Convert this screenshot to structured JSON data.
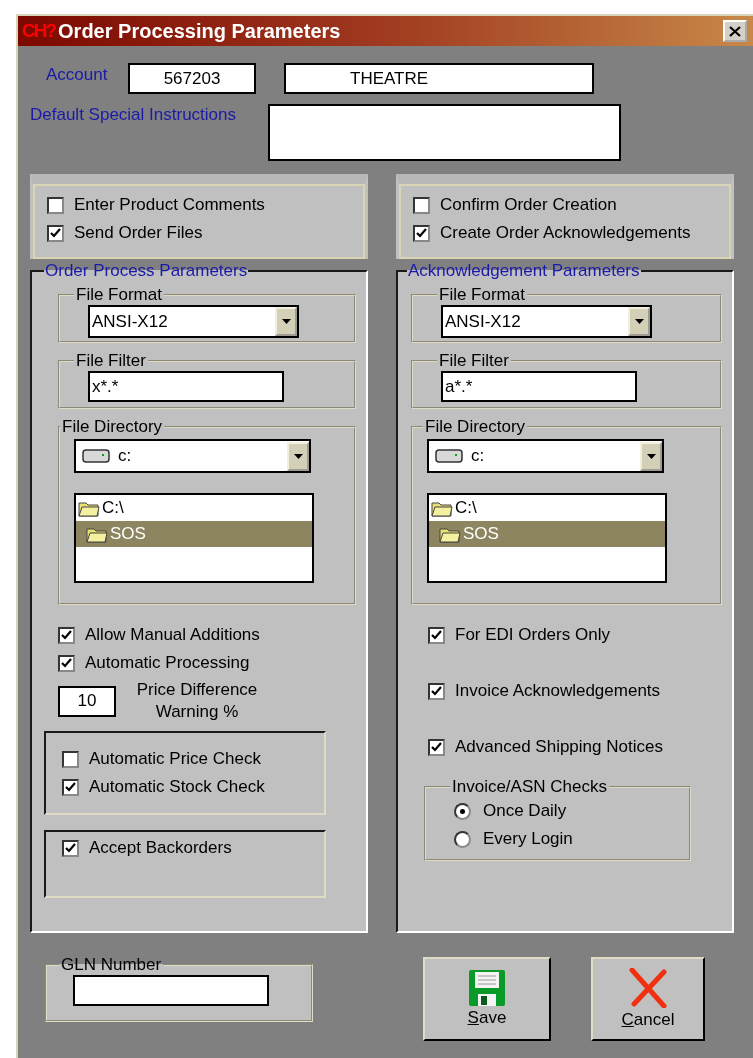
{
  "window": {
    "logo": "CH?",
    "title": "Order Processing Parameters"
  },
  "account": {
    "label": "Account",
    "number": "567203",
    "name": "THEATRE"
  },
  "special_instructions": {
    "label": "Default Special Instructions"
  },
  "columns": [
    {
      "options": [
        {
          "label": "Enter Product Comments",
          "checked": false
        },
        {
          "label": "Send Order Files",
          "checked": true
        }
      ],
      "group": {
        "title": "Order Process Parameters",
        "file_format": {
          "label": "File Format",
          "value": "ANSI-X12"
        },
        "file_filter": {
          "label": "File Filter",
          "value": "x*.*"
        },
        "file_directory": {
          "label": "File Directory",
          "drive": "c:",
          "folders": [
            {
              "name": "C:\\",
              "selected": false,
              "children": [
                {
                  "name": "SOS",
                  "selected": true
                }
              ]
            }
          ]
        },
        "items": [
          {
            "kind": "checkbox",
            "label": "Allow Manual Additions",
            "checked": true
          },
          {
            "kind": "checkbox",
            "label": "Automatic Processing",
            "checked": true
          },
          {
            "kind": "number",
            "value": "10",
            "label": "Price Difference Warning %"
          },
          {
            "kind": "checkgroup",
            "options": [
              {
                "label": "Automatic Price Check",
                "checked": false
              },
              {
                "label": "Automatic Stock Check",
                "checked": true
              }
            ]
          },
          {
            "kind": "checkgroup",
            "options": [
              {
                "label": "Accept Backorders",
                "checked": true
              }
            ]
          }
        ]
      }
    },
    {
      "options": [
        {
          "label": "Confirm Order Creation",
          "checked": false
        },
        {
          "label": "Create Order Acknowledgements",
          "checked": true
        }
      ],
      "group": {
        "title": "Acknowledgement Parameters",
        "file_format": {
          "label": "File Format",
          "value": "ANSI-X12"
        },
        "file_filter": {
          "label": "File Filter",
          "value": "a*.*"
        },
        "file_directory": {
          "label": "File Directory",
          "drive": "c:",
          "folders": [
            {
              "name": "C:\\",
              "selected": false,
              "children": [
                {
                  "name": "SOS",
                  "selected": true
                }
              ]
            }
          ]
        },
        "items": [
          {
            "kind": "checkbox",
            "label": "For EDI Orders Only",
            "checked": true
          },
          {
            "kind": "checkbox",
            "label": "Invoice Acknowledgements",
            "checked": true
          },
          {
            "kind": "checkbox",
            "label": "Advanced Shipping Notices",
            "checked": true
          },
          {
            "kind": "radiogroup",
            "title": "Invoice/ASN Checks",
            "options": [
              {
                "label": "Once Daily",
                "selected": true
              },
              {
                "label": "Every Login",
                "selected": false
              }
            ]
          }
        ]
      }
    }
  ],
  "gln": {
    "label": "GLN Number"
  },
  "buttons": [
    {
      "kind": "save",
      "label": "Save",
      "access_key_underlined": true
    },
    {
      "kind": "cancel",
      "label": "Cancel",
      "access_key_underlined": true
    }
  ]
}
